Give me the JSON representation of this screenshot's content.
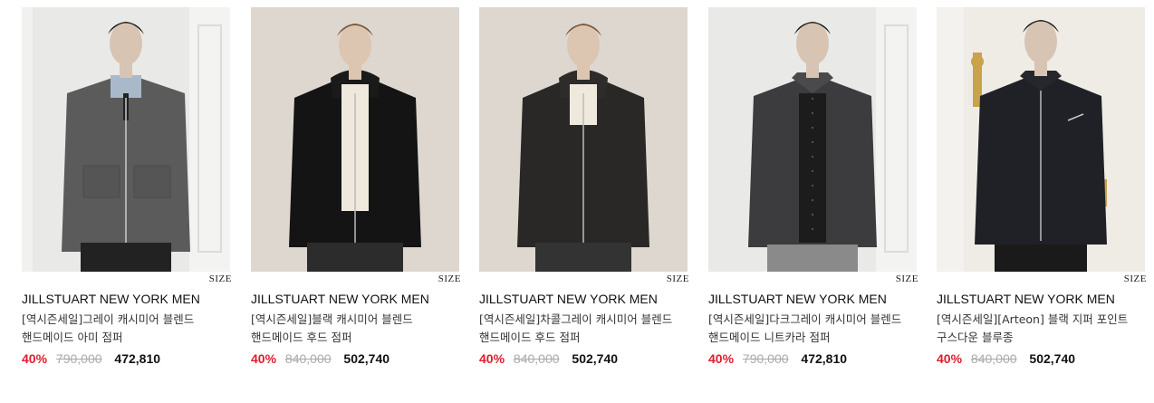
{
  "size_label": "SIZE",
  "products": [
    {
      "brand": "JILLSTUART NEW YORK MEN",
      "name": "[역시즌세일]그레이 캐시미어 블렌드 핸드메이드 아미 점퍼",
      "discount": "40%",
      "original_price": "790,000",
      "sale_price": "472,810",
      "image": "gray-zip-jacket-model"
    },
    {
      "brand": "JILLSTUART NEW YORK MEN",
      "name": "[역시즌세일]블랙 캐시미어 블렌드 핸드메이드 후드 점퍼",
      "discount": "40%",
      "original_price": "840,000",
      "sale_price": "502,740",
      "image": "black-hooded-jacket-model"
    },
    {
      "brand": "JILLSTUART NEW YORK MEN",
      "name": "[역시즌세일]차콜그레이 캐시미어 블렌드 핸드메이드 후드 점퍼",
      "discount": "40%",
      "original_price": "840,000",
      "sale_price": "502,740",
      "image": "charcoal-hooded-jacket-model"
    },
    {
      "brand": "JILLSTUART NEW YORK MEN",
      "name": "[역시즌세일]다크그레이 캐시미어 블렌드 핸드메이드 니트카라 점퍼",
      "discount": "40%",
      "original_price": "790,000",
      "sale_price": "472,810",
      "image": "darkgray-knit-collar-jacket-model"
    },
    {
      "brand": "JILLSTUART NEW YORK MEN",
      "name": "[역시즌세일][Arteon] 블랙 지퍼 포인트 구스다운 블루종",
      "discount": "40%",
      "original_price": "840,000",
      "sale_price": "502,740",
      "image": "black-down-blouson-model"
    }
  ]
}
